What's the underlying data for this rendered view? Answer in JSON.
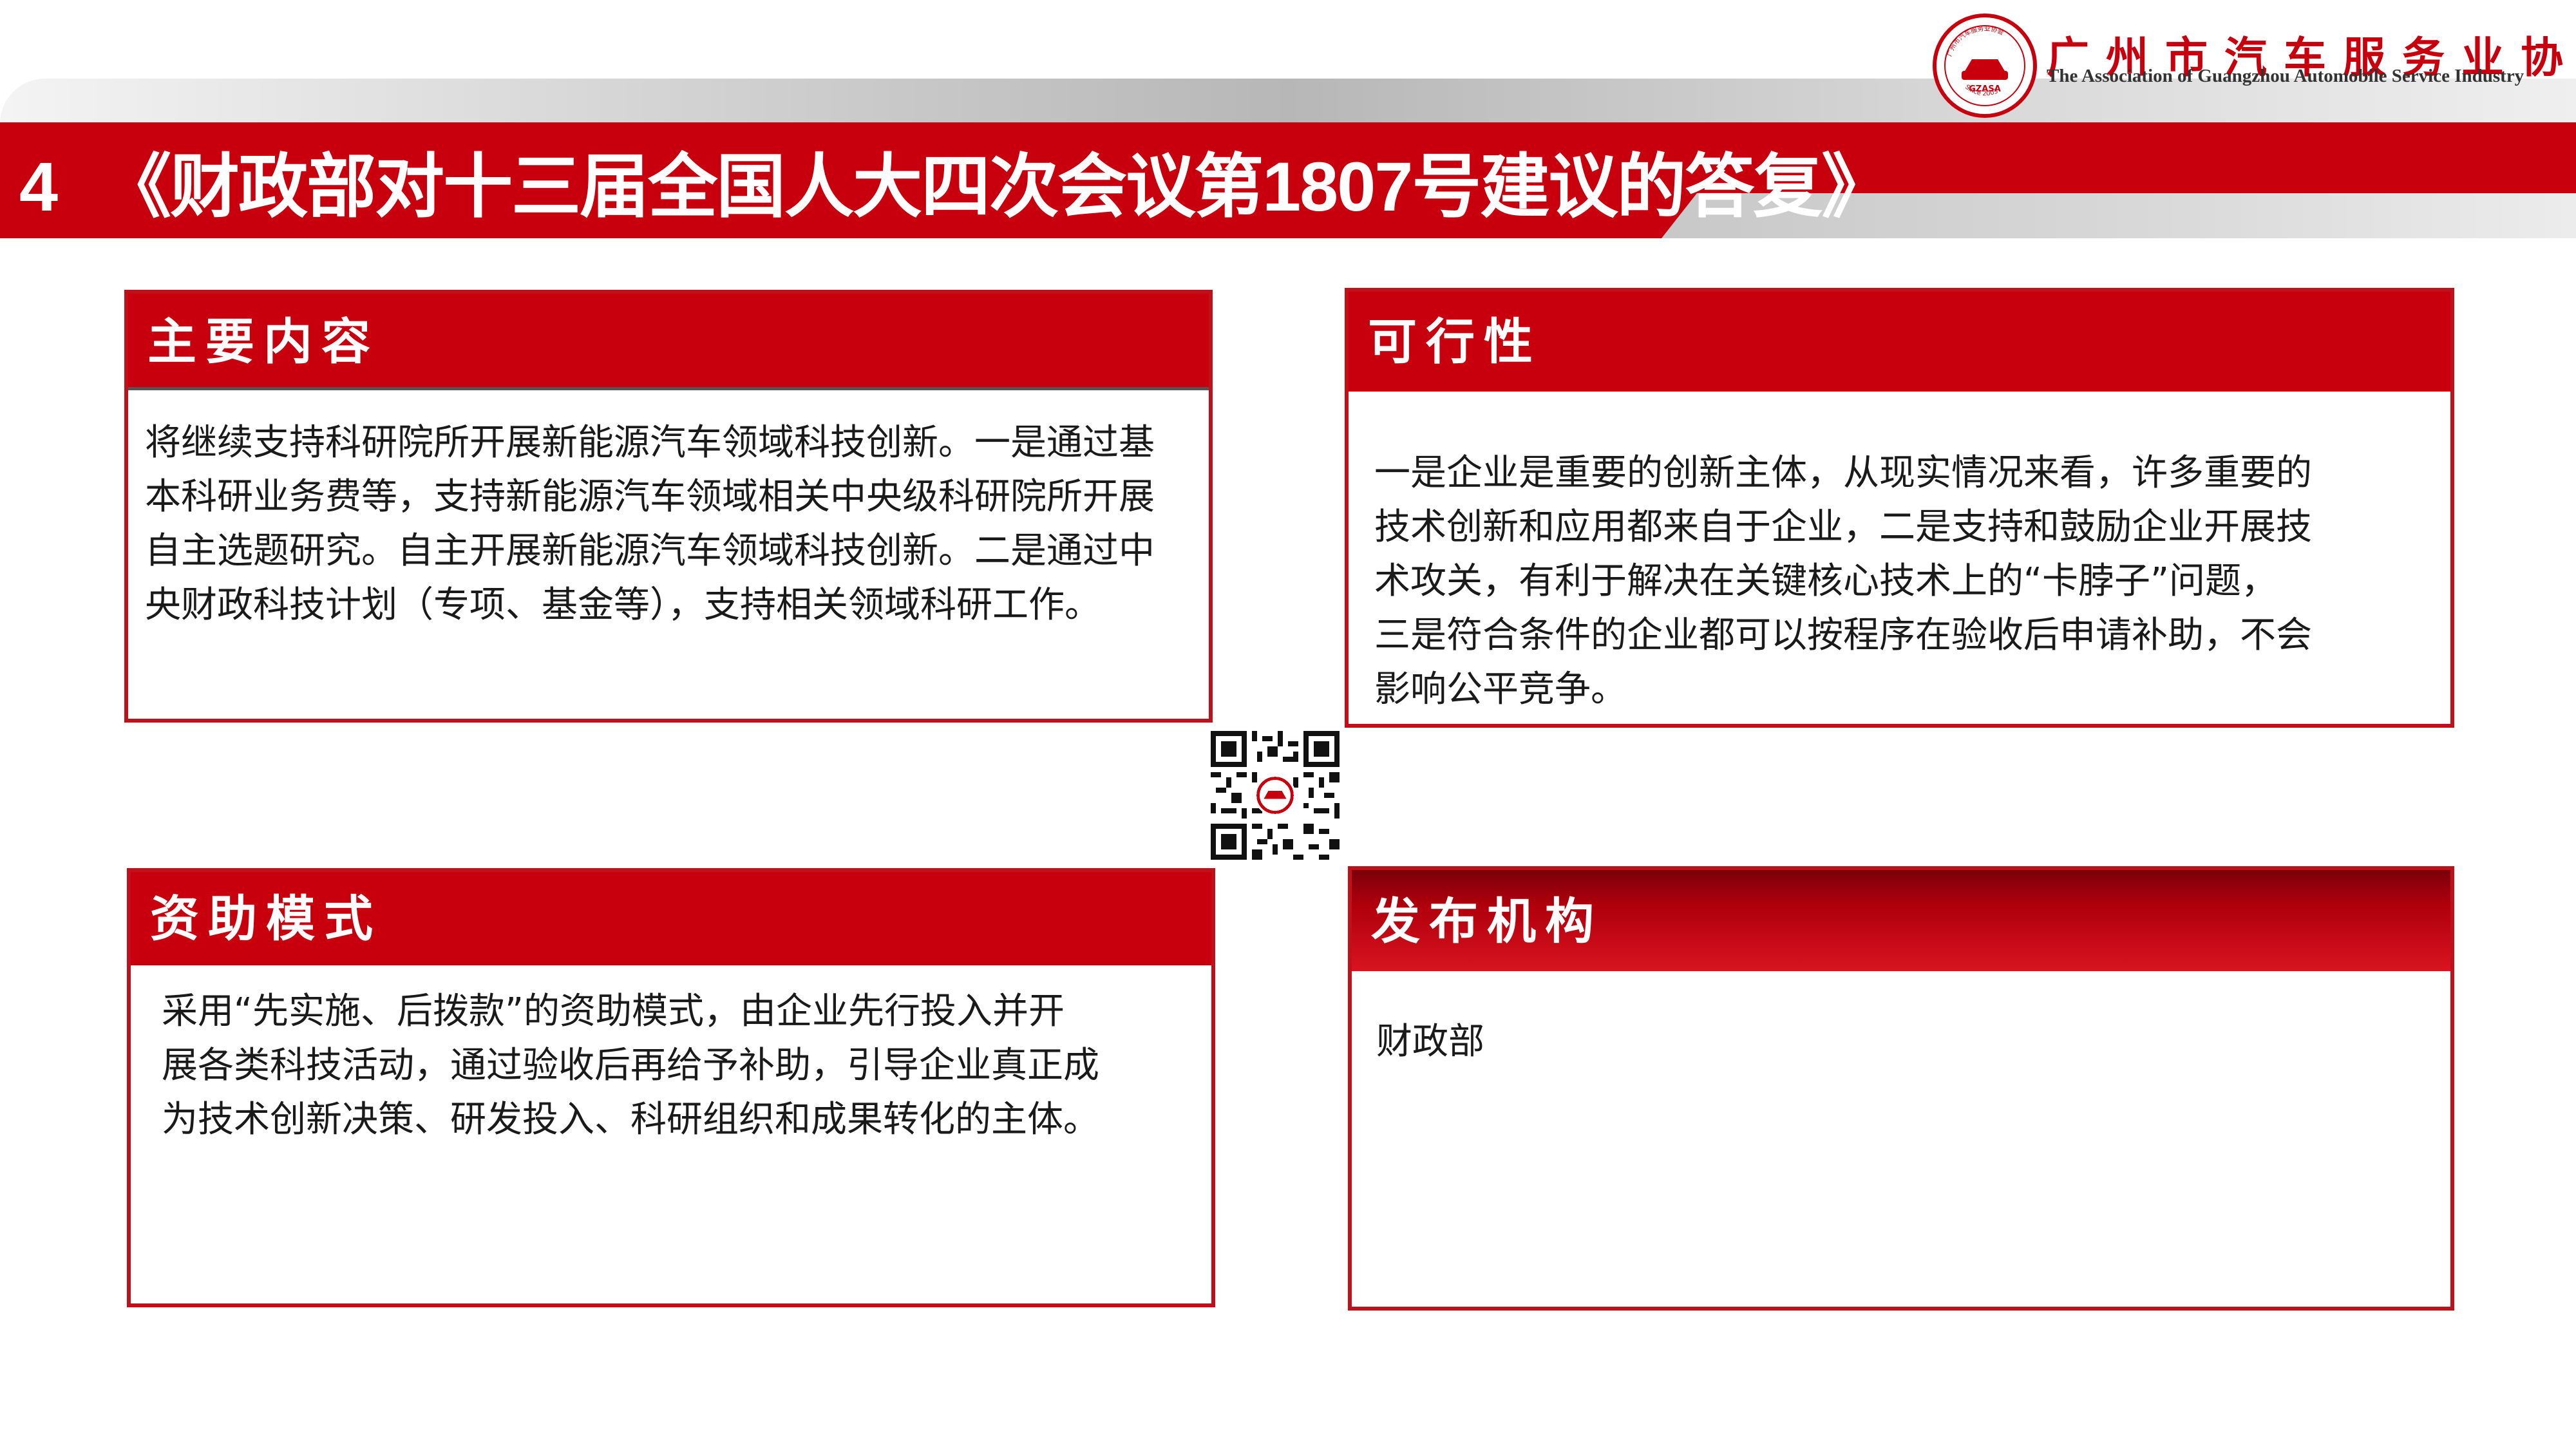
{
  "header": {
    "number": "4",
    "title": "《财政部对十三届全国人大四次会议第1807号建议的答复》"
  },
  "brand": {
    "name_cn": "广州市汽车服务业协会",
    "name_en": "The Association of Guangzhou Automobile Service Industry",
    "logo_text_top": "广州市汽车服务业协会",
    "logo_abbr": "GZASA",
    "logo_since": "Since 2003"
  },
  "panels": {
    "main": {
      "heading": "主要内容",
      "lines": [
        "将继续支持科研院所开展新能源汽车领域科技创新。一是通过基",
        "本科研业务费等，支持新能源汽车领域相关中央级科研院所开展",
        "自主选题研究。自主开展新能源汽车领域科技创新。二是通过中",
        "央财政科技计划（专项、基金等），支持相关领域科研工作。"
      ]
    },
    "feasibility": {
      "heading": "可行性",
      "lines": [
        "一是企业是重要的创新主体，从现实情况来看，许多重要的",
        "技术创新和应用都来自于企业，二是支持和鼓励企业开展技",
        "术攻关，有利于解决在关键核心技术上的“卡脖子”问题，",
        "三是符合条件的企业都可以按程序在验收后申请补助，不会",
        "影响公平竞争。"
      ]
    },
    "funding": {
      "heading": "资助模式",
      "lines": [
        "采用“先实施、后拨款”的资助模式，由企业先行投入并开",
        "展各类科技活动，通过验收后再给予补助，引导企业真正成",
        "为技术创新决策、研发投入、科研组织和成果转化的主体。"
      ]
    },
    "publisher": {
      "heading": "发布机构",
      "lines": [
        "财政部"
      ]
    }
  },
  "colors": {
    "accent": "#c8000e",
    "border": "#c0101a",
    "text": "#1a1a1a"
  },
  "icons": {
    "logo": "association-seal-logo",
    "qr": "qr-code"
  }
}
